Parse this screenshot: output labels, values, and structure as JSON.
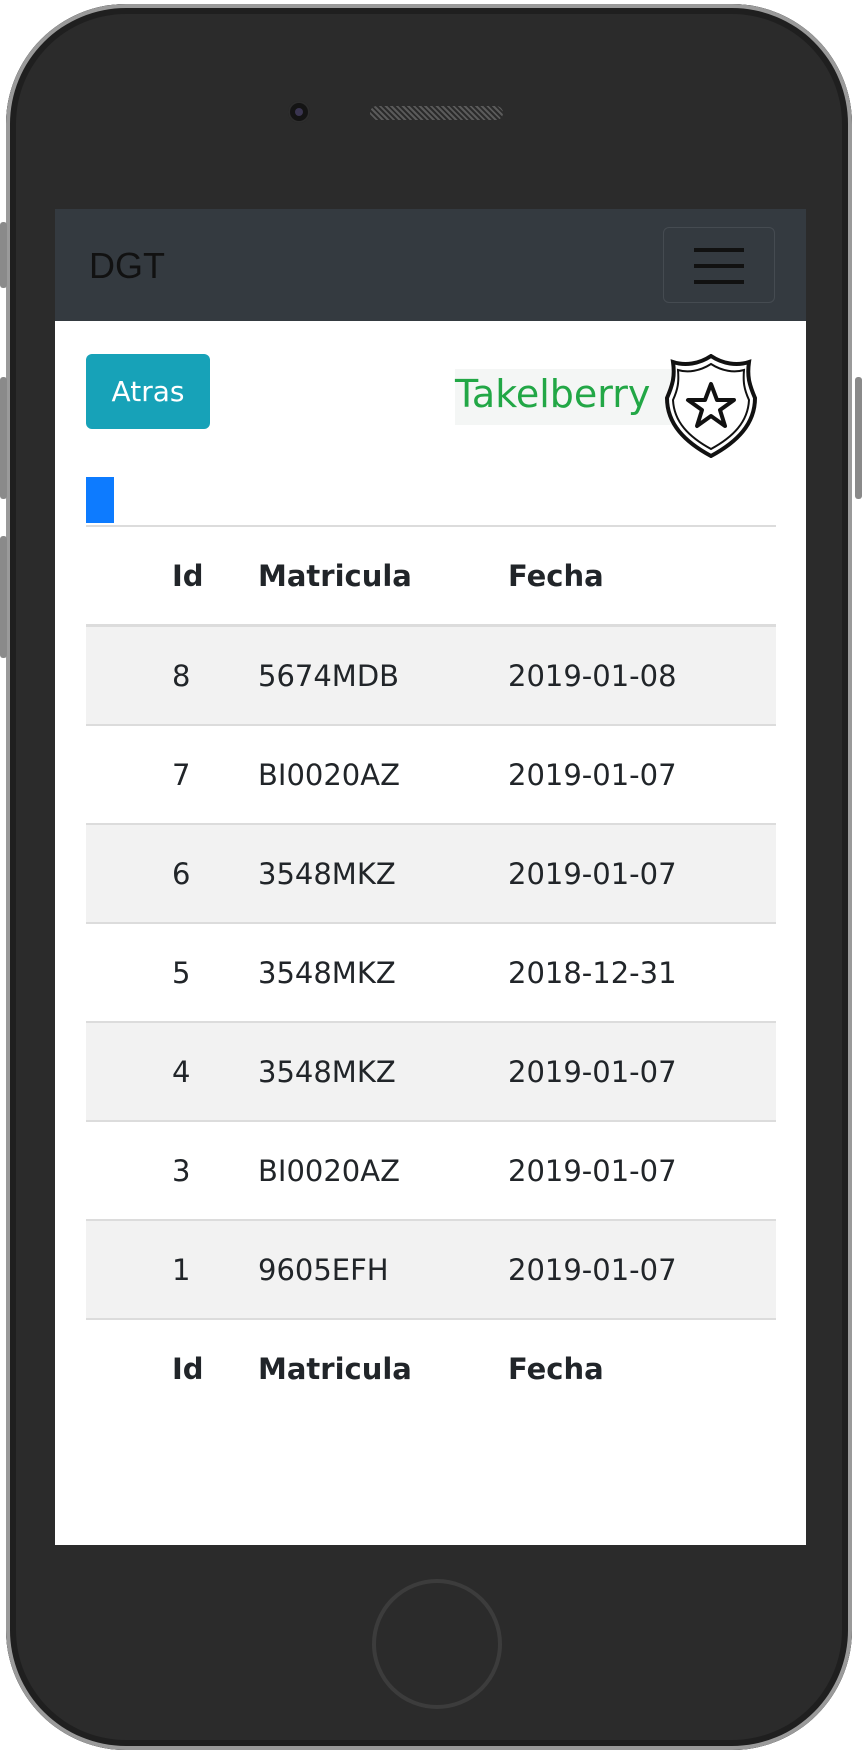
{
  "navbar": {
    "brand": "DGT",
    "toggler_icon": "hamburger-menu-icon"
  },
  "actions": {
    "back_label": "Atras"
  },
  "logo": {
    "text": "Takelberry",
    "icon": "police-badge-star-icon",
    "text_color": "#22a746"
  },
  "colors": {
    "navbar_bg": "#343a40",
    "back_button": "#17a2b8",
    "blue_block": "#0d7bff"
  },
  "table": {
    "headers": [
      "Id",
      "Matricula",
      "Fecha"
    ],
    "rows": [
      {
        "id": "8",
        "matricula": "5674MDB",
        "fecha": "2019-01-08"
      },
      {
        "id": "7",
        "matricula": "BI0020AZ",
        "fecha": "2019-01-07"
      },
      {
        "id": "6",
        "matricula": "3548MKZ",
        "fecha": "2019-01-07"
      },
      {
        "id": "5",
        "matricula": "3548MKZ",
        "fecha": "2018-12-31"
      },
      {
        "id": "4",
        "matricula": "3548MKZ",
        "fecha": "2019-01-07"
      },
      {
        "id": "3",
        "matricula": "BI0020AZ",
        "fecha": "2019-01-07"
      },
      {
        "id": "1",
        "matricula": "9605EFH",
        "fecha": "2019-01-07"
      }
    ],
    "footers": [
      "Id",
      "Matricula",
      "Fecha"
    ]
  }
}
